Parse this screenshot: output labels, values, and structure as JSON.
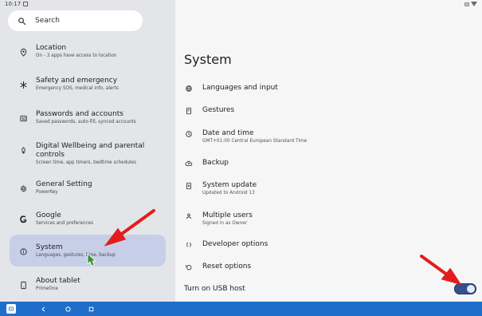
{
  "status_bar": {
    "time": "10:17"
  },
  "search": {
    "placeholder": "Search"
  },
  "left_menu": [
    {
      "title": "Location",
      "subtitle": "On - 3 apps have access to location",
      "icon": "location-pin-icon"
    },
    {
      "title": "Safety and emergency",
      "subtitle": "Emergency SOS, medical info, alerts",
      "icon": "asterisk-icon"
    },
    {
      "title": "Passwords and accounts",
      "subtitle": "Saved passwords, auto-fill, synced accounts",
      "icon": "account-card-icon"
    },
    {
      "title": "Digital Wellbeing and parental controls",
      "subtitle": "Screen time, app timers, bedtime schedules",
      "icon": "wellbeing-icon"
    },
    {
      "title": "General Setting",
      "subtitle": "PowerKey",
      "icon": "gear-icon"
    },
    {
      "title": "Google",
      "subtitle": "Services and preferences",
      "icon": "google-icon"
    },
    {
      "title": "System",
      "subtitle": "Languages, gestures, time, backup",
      "icon": "info-icon"
    },
    {
      "title": "About tablet",
      "subtitle": "PrimeOne",
      "icon": "tablet-icon"
    }
  ],
  "page": {
    "title": "System"
  },
  "system_items": [
    {
      "title": "Languages and input",
      "subtitle": "",
      "icon": "globe-icon"
    },
    {
      "title": "Gestures",
      "subtitle": "",
      "icon": "phone-gesture-icon"
    },
    {
      "title": "Date and time",
      "subtitle": "GMT+01:00 Central European Standard Time",
      "icon": "clock-icon"
    },
    {
      "title": "Backup",
      "subtitle": "",
      "icon": "cloud-backup-icon"
    },
    {
      "title": "System update",
      "subtitle": "Updated to Android 13",
      "icon": "system-update-icon"
    },
    {
      "title": "Multiple users",
      "subtitle": "Signed in as Owner",
      "icon": "user-icon"
    },
    {
      "title": "Developer options",
      "subtitle": "",
      "icon": "braces-icon"
    },
    {
      "title": "Reset options",
      "subtitle": "",
      "icon": "reset-icon"
    }
  ],
  "usb_host": {
    "label": "Turn on USB host",
    "enabled": true
  },
  "colors": {
    "left_bg": "#e4e5e8",
    "selected_bg": "#c6cfe7",
    "toggle_on": "#35518d",
    "nav_bar": "#1f6fca",
    "arrow": "#e31d1d"
  }
}
